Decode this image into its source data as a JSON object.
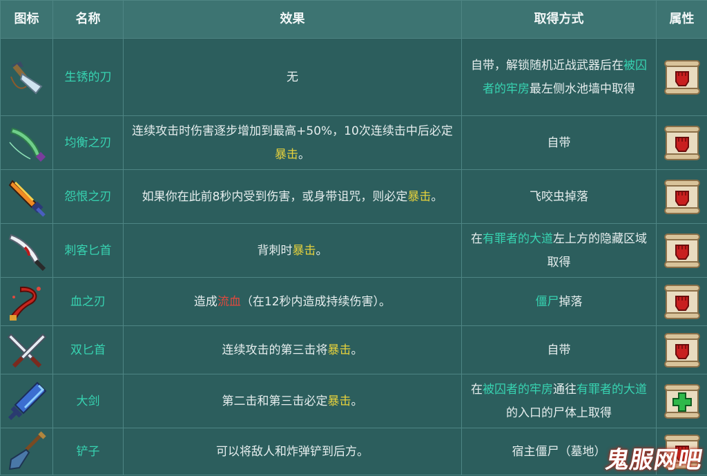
{
  "header": {
    "icon": "图标",
    "name": "名称",
    "effect": "效果",
    "obtain": "取得方式",
    "attr": "属性"
  },
  "rows": [
    {
      "icon": "rusty-sword-icon",
      "name": "生锈的刀",
      "effect": [
        {
          "t": "无"
        }
      ],
      "obtain": [
        {
          "t": "自带，解锁随机近战武器后在"
        },
        {
          "t": "被囚者的牢房",
          "c": "teal"
        },
        {
          "t": "最左侧水池墙中取得"
        }
      ],
      "attr": "brutality-scroll-icon"
    },
    {
      "icon": "balanced-blade-icon",
      "name": "均衡之刃",
      "effect": [
        {
          "t": "连续攻击时伤害逐步增加到最高+50%，10次连续击中后必定"
        },
        {
          "t": "暴击",
          "c": "yellow"
        },
        {
          "t": "。"
        }
      ],
      "obtain": [
        {
          "t": "自带"
        }
      ],
      "attr": "brutality-scroll-icon"
    },
    {
      "icon": "blood-sword-grudge-icon",
      "name": "怨恨之刃",
      "effect": [
        {
          "t": "如果你在此前8秒内受到伤害，或身带诅咒，则必定"
        },
        {
          "t": "暴击",
          "c": "yellow"
        },
        {
          "t": "。"
        }
      ],
      "obtain": [
        {
          "t": "飞咬虫掉落"
        }
      ],
      "attr": "brutality-scroll-icon"
    },
    {
      "icon": "assassin-dagger-icon",
      "name": "刺客匕首",
      "effect": [
        {
          "t": "背刺时"
        },
        {
          "t": "暴击",
          "c": "yellow"
        },
        {
          "t": "。"
        }
      ],
      "obtain": [
        {
          "t": "在"
        },
        {
          "t": "有罪者的大道",
          "c": "teal"
        },
        {
          "t": "左上方的隐藏区域取得"
        }
      ],
      "attr": "brutality-scroll-icon"
    },
    {
      "icon": "blood-sword-icon",
      "name": "血之刃",
      "effect": [
        {
          "t": "造成"
        },
        {
          "t": "流血",
          "c": "red"
        },
        {
          "t": "（在12秒内造成持续伤害）。"
        }
      ],
      "obtain": [
        {
          "t": "僵尸",
          "c": "teal"
        },
        {
          "t": "掉落"
        }
      ],
      "attr": "brutality-scroll-icon"
    },
    {
      "icon": "twin-daggers-icon",
      "name": "双匕首",
      "effect": [
        {
          "t": "连续攻击的第三击将"
        },
        {
          "t": "暴击",
          "c": "yellow"
        },
        {
          "t": "。"
        }
      ],
      "obtain": [
        {
          "t": "自带"
        }
      ],
      "attr": "brutality-scroll-icon"
    },
    {
      "icon": "broadsword-icon",
      "name": "大剑",
      "effect": [
        {
          "t": "第二击和第三击必定"
        },
        {
          "t": "暴击",
          "c": "yellow"
        },
        {
          "t": "。"
        }
      ],
      "obtain": [
        {
          "t": "在"
        },
        {
          "t": "被囚者的牢房",
          "c": "teal"
        },
        {
          "t": "通往"
        },
        {
          "t": "有罪者的大道",
          "c": "teal"
        },
        {
          "t": "的入口的尸体上取得"
        }
      ],
      "attr": "survival-scroll-icon"
    },
    {
      "icon": "shovel-icon",
      "name": "铲子",
      "effect": [
        {
          "t": "可以将敌人和炸弹铲到后方。"
        }
      ],
      "obtain": [
        {
          "t": "宿主僵尸（墓地）"
        }
      ],
      "attr": "brutality-scroll-icon"
    }
  ],
  "watermark": "鬼服网吧",
  "colors": {
    "background": "#2b5c5b",
    "header": "#3d7472",
    "teal": "#37d3b1",
    "yellow": "#e7d23c",
    "red": "#e0493e"
  }
}
